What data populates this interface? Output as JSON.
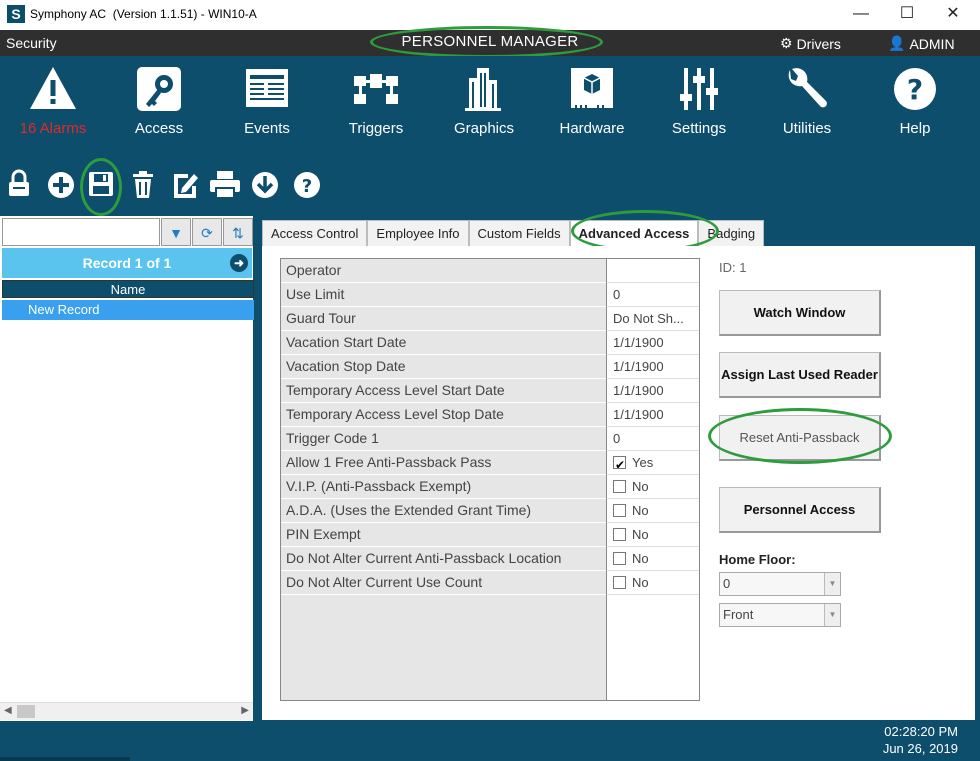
{
  "window": {
    "app_icon_letter": "S",
    "title": "Symphony AC  (Version 1.1.51) - WIN10-A",
    "controls": [
      "minimize-icon",
      "maximize-icon",
      "close-icon"
    ]
  },
  "header": {
    "section": "Security",
    "title": "PERSONNEL MANAGER",
    "drivers": "Drivers",
    "user": "ADMIN"
  },
  "nav": {
    "items": [
      {
        "label": "16 Alarms",
        "icon": "alarm-icon"
      },
      {
        "label": "Access",
        "icon": "key-icon"
      },
      {
        "label": "Events",
        "icon": "events-icon"
      },
      {
        "label": "Triggers",
        "icon": "triggers-icon"
      },
      {
        "label": "Graphics",
        "icon": "building-icon"
      },
      {
        "label": "Hardware",
        "icon": "hardware-icon"
      },
      {
        "label": "Settings",
        "icon": "sliders-icon"
      },
      {
        "label": "Utilities",
        "icon": "wrench-icon"
      },
      {
        "label": "Help",
        "icon": "help-icon"
      }
    ]
  },
  "toolbar": {
    "tools": [
      "lock-icon",
      "add-icon",
      "save-icon",
      "delete-icon",
      "edit-icon",
      "print-icon",
      "download-icon",
      "help-icon"
    ]
  },
  "left_panel": {
    "search_value": "",
    "record_label": "Record 1 of 1",
    "column_header": "Name",
    "rows": [
      "New Record"
    ]
  },
  "tabs": [
    "Access Control",
    "Employee Info",
    "Custom Fields",
    "Advanced Access",
    "Badging"
  ],
  "active_tab": "Advanced Access",
  "grid": {
    "rows": [
      {
        "name": "Operator",
        "value": ""
      },
      {
        "name": "Use Limit",
        "value": "0"
      },
      {
        "name": "Guard Tour",
        "value": "Do Not Sh..."
      },
      {
        "name": "Vacation Start Date",
        "value": "1/1/1900"
      },
      {
        "name": "Vacation Stop Date",
        "value": "1/1/1900"
      },
      {
        "name": "Temporary Access Level Start Date",
        "value": "1/1/1900"
      },
      {
        "name": "Temporary Access Level Stop Date",
        "value": "1/1/1900"
      },
      {
        "name": "Trigger Code 1",
        "value": "0"
      },
      {
        "name": "Allow 1 Free Anti-Passback Pass",
        "value": "Yes",
        "checked": true
      },
      {
        "name": "V.I.P. (Anti-Passback Exempt)",
        "value": "No",
        "checked": false
      },
      {
        "name": "A.D.A. (Uses the Extended Grant Time)",
        "value": "No",
        "checked": false
      },
      {
        "name": "PIN Exempt",
        "value": "No",
        "checked": false
      },
      {
        "name": "Do Not Alter Current Anti-Passback Location",
        "value": "No",
        "checked": false
      },
      {
        "name": "Do Not Alter Current Use Count",
        "value": "No",
        "checked": false
      }
    ]
  },
  "side": {
    "id_label": "ID:  1",
    "buttons": [
      "Watch Window",
      "Assign Last Used Reader",
      "Reset Anti-Passback",
      "Personnel Access"
    ],
    "home_floor_label": "Home Floor:",
    "home_floor_value": "0",
    "location_value": "Front"
  },
  "status": {
    "time": "02:28:20 PM",
    "date": "Jun 26, 2019"
  },
  "colors": {
    "nav_bg": "#0c4e6c",
    "header_bg": "#2f2f2f",
    "record_bar": "#5bc4ee",
    "selection": "#39a0f0",
    "alarm_text": "#e02a2a",
    "highlight_oval": "#2e9c3c"
  }
}
